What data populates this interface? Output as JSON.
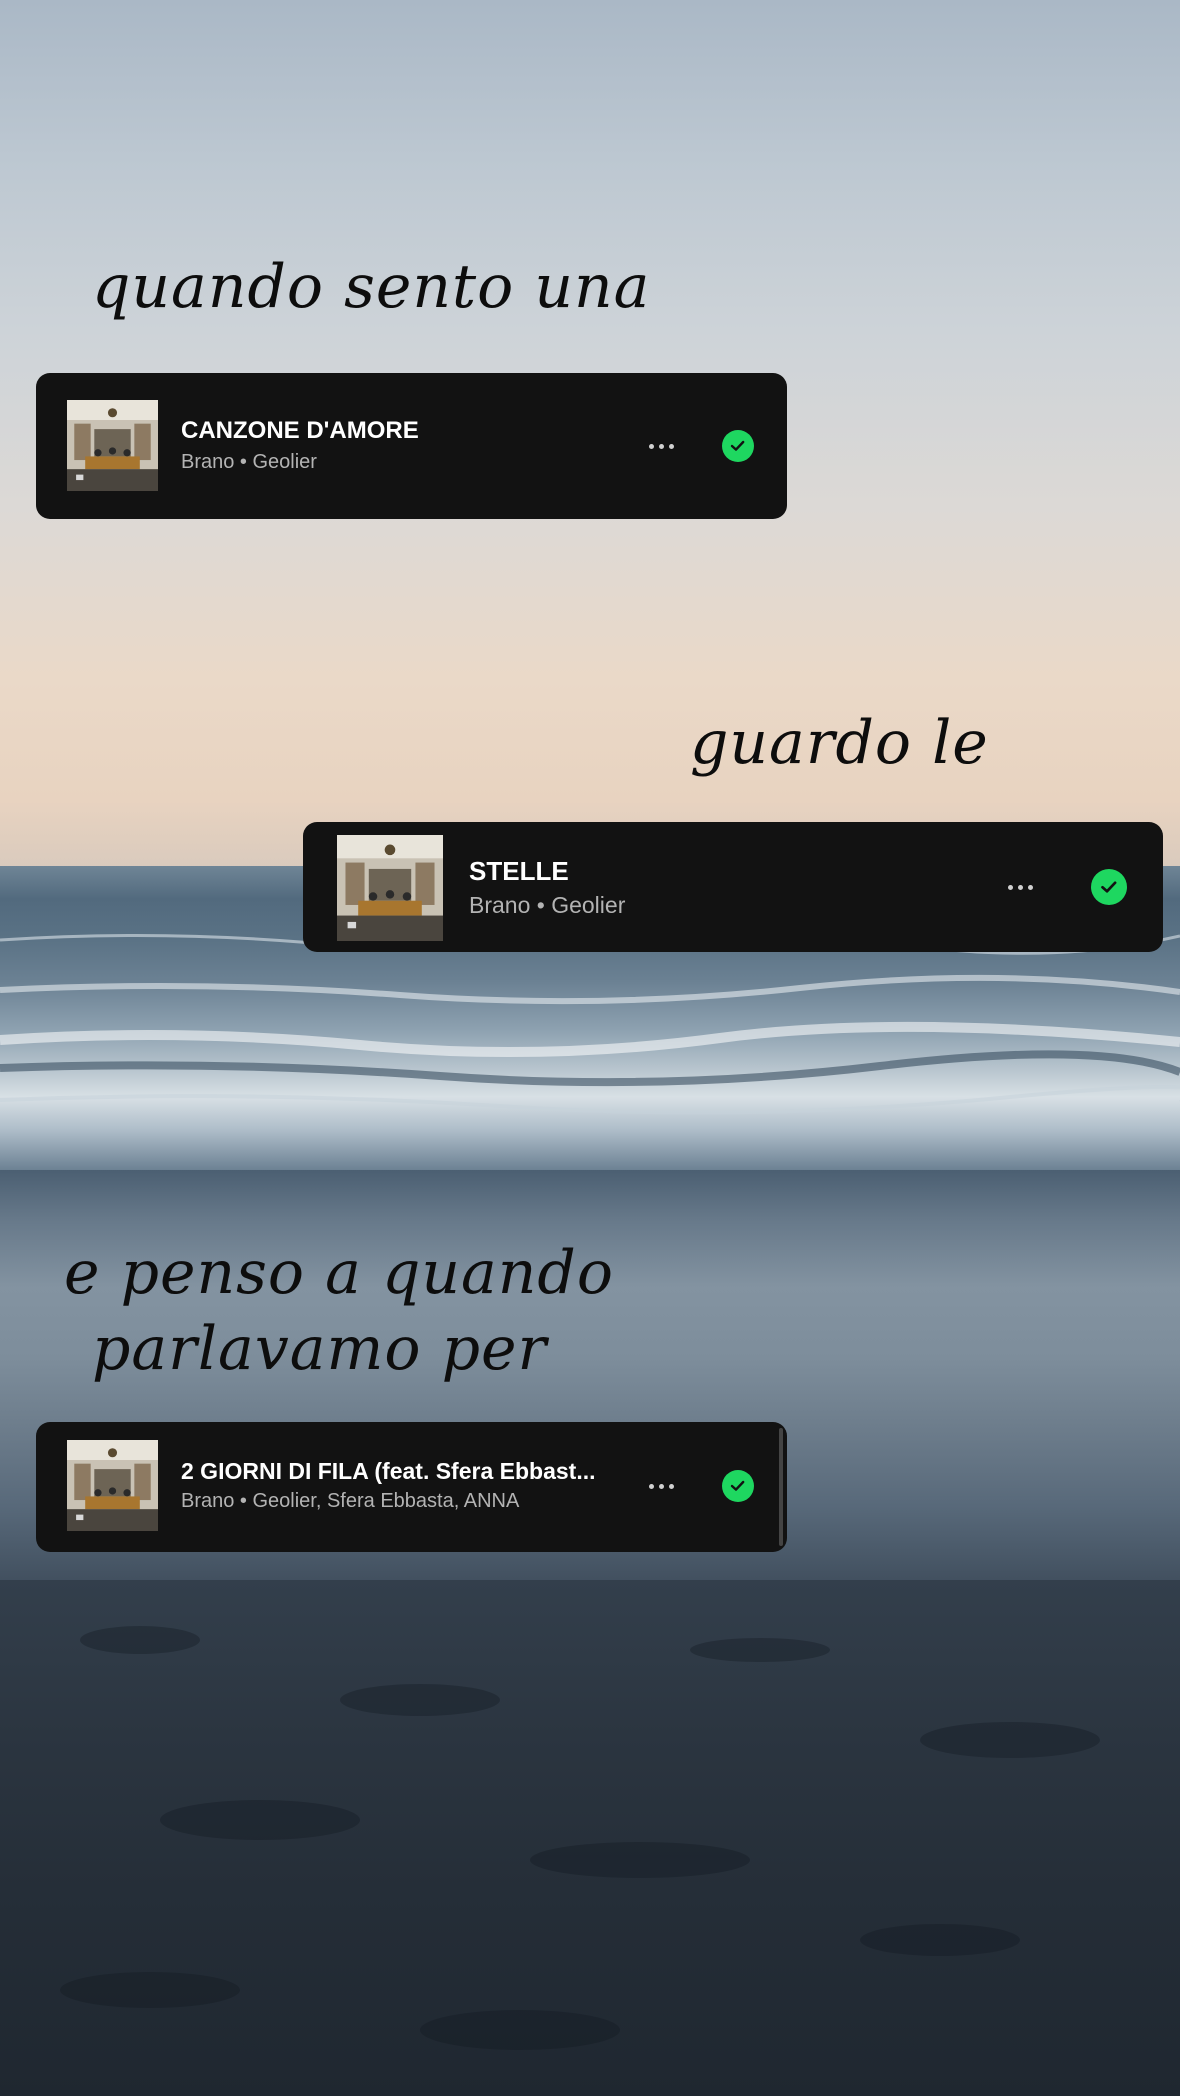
{
  "captions": {
    "line1": "quando sento una",
    "line2": "guardo le",
    "line3a": "e penso a quando",
    "line3b": "parlavamo per"
  },
  "tracks": [
    {
      "title": "CANZONE D'AMORE",
      "subtitle": "Brano • Geolier",
      "more_icon": "more-horizontal-icon",
      "saved_icon": "check-circle-icon"
    },
    {
      "title": "STELLE",
      "subtitle": "Brano • Geolier",
      "more_icon": "more-horizontal-icon",
      "saved_icon": "check-circle-icon"
    },
    {
      "title": "2 GIORNI DI FILA (feat. Sfera Ebbast...",
      "subtitle": "Brano • Geolier, Sfera Ebbasta, ANNA",
      "more_icon": "more-horizontal-icon",
      "saved_icon": "check-circle-icon"
    }
  ],
  "colors": {
    "card_bg": "#121212",
    "accent_green": "#1ed760",
    "title_text": "#ffffff",
    "subtitle_text": "#b3b3b3",
    "caption_text": "#0d0d0d"
  }
}
